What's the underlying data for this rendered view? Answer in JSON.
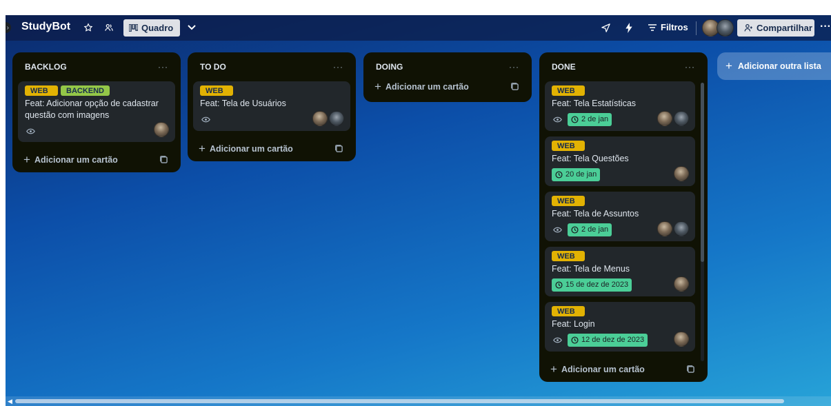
{
  "board": {
    "title": "StudyBot",
    "view_label": "Quadro",
    "filters_label": "Filtros",
    "share_label": "Compartilhar",
    "more": "···",
    "background": [
      "#0b2a6b",
      "#0c4ea8",
      "#27a3d8"
    ]
  },
  "lists": [
    {
      "title": "BACKLOG",
      "menu": "···",
      "cards": [
        {
          "labels": [
            "WEB",
            "BACKEND"
          ],
          "title": "Feat: Adicionar opção de cadastrar questão com imagens"
        }
      ],
      "add_card": "Adicionar um cartão"
    },
    {
      "title": "TO DO",
      "menu": "···",
      "cards": [
        {
          "labels": [
            "WEB"
          ],
          "title": "Feat: Tela de Usuários"
        }
      ],
      "add_card": "Adicionar um cartão"
    },
    {
      "title": "DOING",
      "menu": "···",
      "cards": [],
      "add_card": "Adicionar um cartão"
    },
    {
      "title": "DONE",
      "menu": "···",
      "cards": [
        {
          "labels": [
            "WEB"
          ],
          "title": "Feat: Tela Estatísticas",
          "due": "2 de jan"
        },
        {
          "labels": [
            "WEB"
          ],
          "title": "Feat: Tela Questões",
          "due": "20 de jan"
        },
        {
          "labels": [
            "WEB"
          ],
          "title": "Feat: Tela de Assuntos",
          "due": "2 de jan"
        },
        {
          "labels": [
            "WEB"
          ],
          "title": "Feat: Tela de Menus",
          "due": "15 de dez de 2023"
        },
        {
          "labels": [
            "WEB"
          ],
          "title": "Feat: Login",
          "due": "12 de dez de 2023"
        }
      ],
      "add_card": "Adicionar um cartão"
    }
  ],
  "add_list": "Adicionar outra lista",
  "colors": {
    "list_bg": "#101204",
    "card_bg": "#22272b",
    "label_web": "#e2b203",
    "label_backend": "#94c748",
    "due_complete": "#4bce97"
  }
}
